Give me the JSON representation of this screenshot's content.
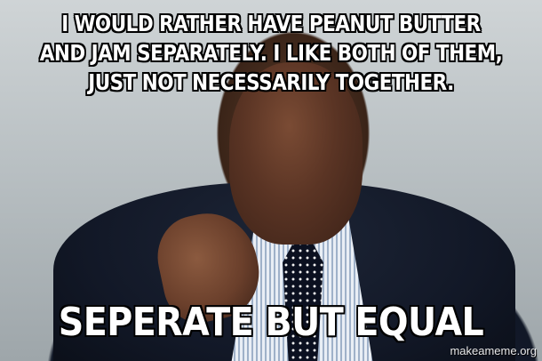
{
  "meme": {
    "top_text": "I WOULD RATHER HAVE PEANUT BUTTER AND JAM SEPARATELY. I LIKE BOTH OF THEM, JUST NOT NECESSARILY TOGETHER.",
    "bottom_text": "SEPERATE BUT EQUAL"
  },
  "watermark": "makeameme.org",
  "colors": {
    "text": "#ffffff",
    "text_outline": "#000000"
  }
}
